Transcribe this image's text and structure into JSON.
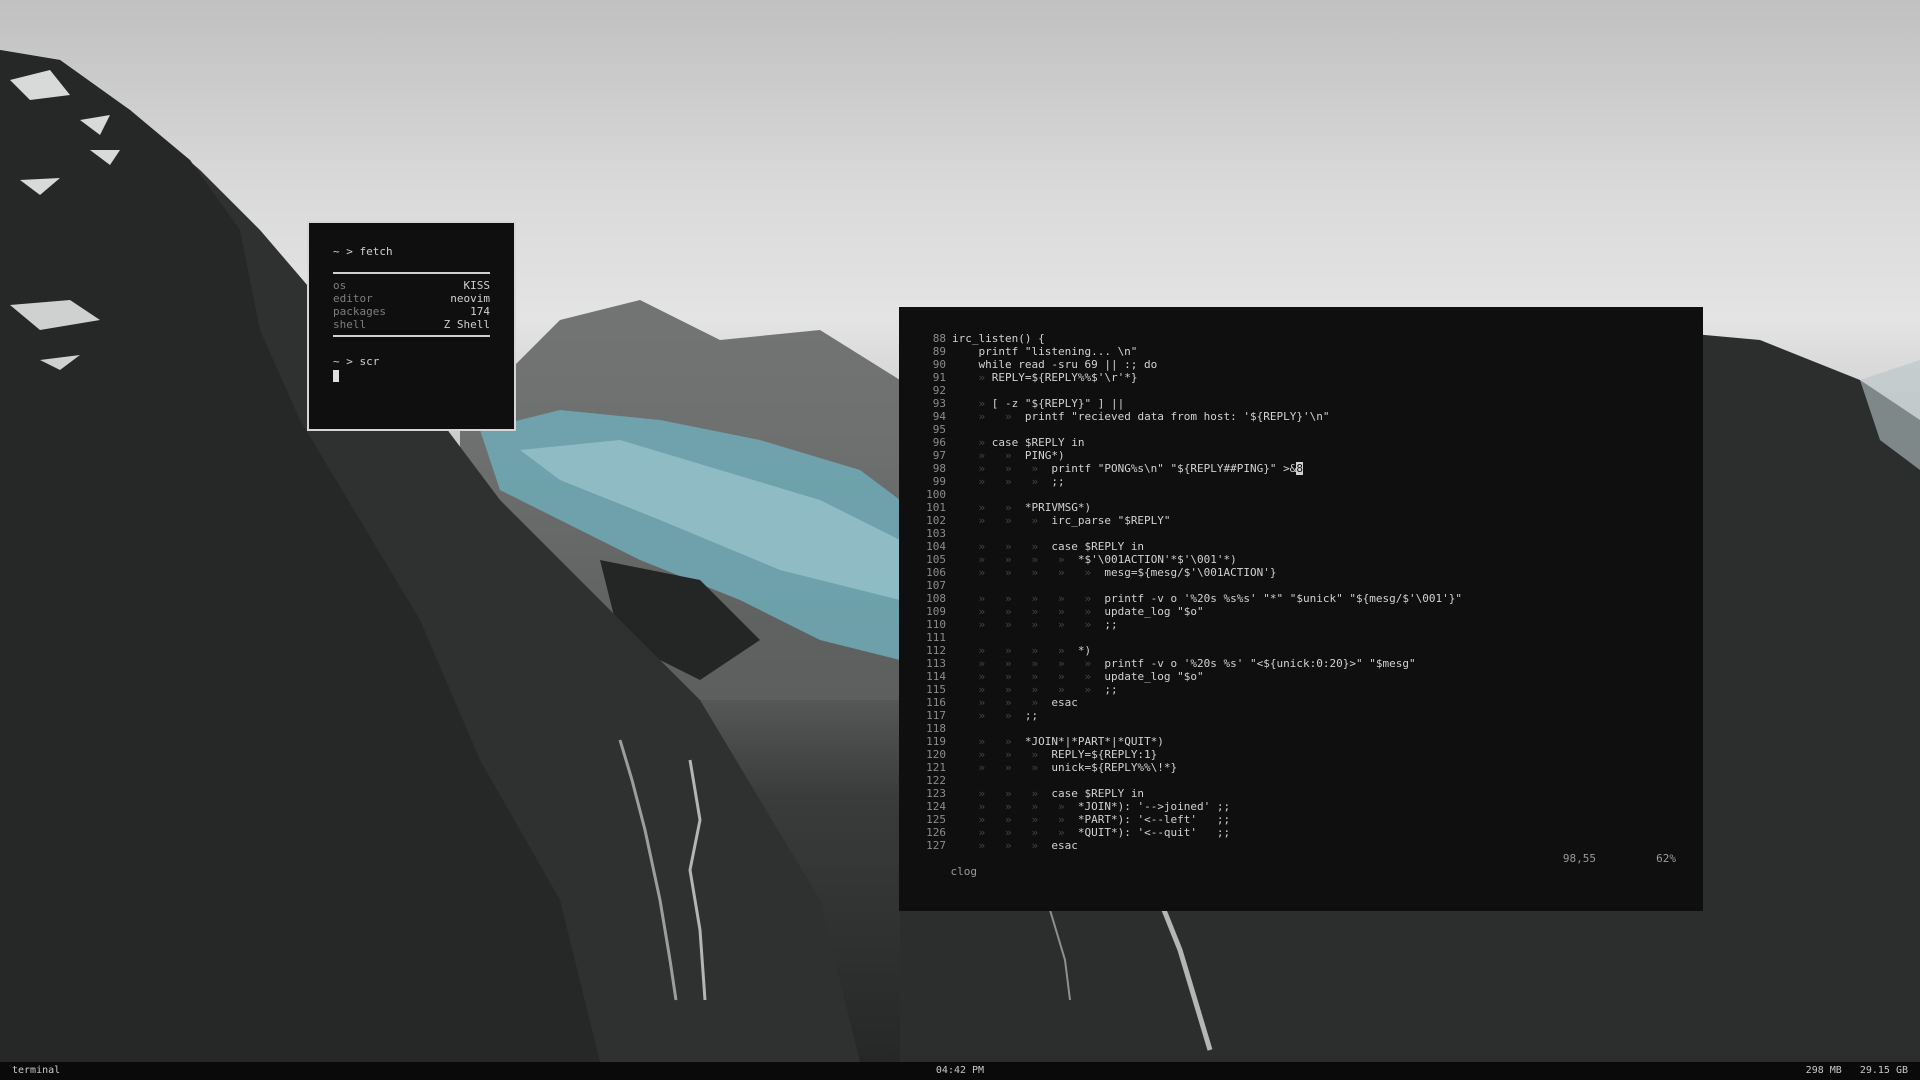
{
  "fetch": {
    "prompt1": "~ > fetch",
    "rows": [
      {
        "key": "os",
        "value": "KISS"
      },
      {
        "key": "editor",
        "value": "neovim"
      },
      {
        "key": "packages",
        "value": "174"
      },
      {
        "key": "shell",
        "value": "Z Shell"
      }
    ],
    "prompt2": "~ > scr"
  },
  "editor": {
    "lines": [
      {
        "n": "88",
        "t": "",
        "c": "irc_listen() {"
      },
      {
        "n": "89",
        "t": "",
        "c": "    printf \"listening... \\n\""
      },
      {
        "n": "90",
        "t": "",
        "c": "    while read -sru 69 || :; do"
      },
      {
        "n": "91",
        "t": "    » ",
        "c": "REPLY=${REPLY%%$'\\r'*}"
      },
      {
        "n": "92",
        "t": "",
        "c": ""
      },
      {
        "n": "93",
        "t": "    » ",
        "c": "[ -z \"${REPLY}\" ] ||"
      },
      {
        "n": "94",
        "t": "    »   »  ",
        "c": "printf \"recieved data from host: '${REPLY}'\\n\""
      },
      {
        "n": "95",
        "t": "",
        "c": ""
      },
      {
        "n": "96",
        "t": "    » ",
        "c": "case $REPLY in"
      },
      {
        "n": "97",
        "t": "    »   »  ",
        "c": "PING*)"
      },
      {
        "n": "98",
        "t": "    »   »   »  ",
        "c": "printf \"PONG%s\\n\" \"${REPLY##PING}\" >&8"
      },
      {
        "n": "99",
        "t": "    »   »   »  ",
        "c": ";;"
      },
      {
        "n": "100",
        "t": "",
        "c": ""
      },
      {
        "n": "101",
        "t": "    »   »  ",
        "c": "*PRIVMSG*)"
      },
      {
        "n": "102",
        "t": "    »   »   »  ",
        "c": "irc_parse \"$REPLY\""
      },
      {
        "n": "103",
        "t": "",
        "c": ""
      },
      {
        "n": "104",
        "t": "    »   »   »  ",
        "c": "case $REPLY in"
      },
      {
        "n": "105",
        "t": "    »   »   »   »  ",
        "c": "*$'\\001ACTION'*$'\\001'*)"
      },
      {
        "n": "106",
        "t": "    »   »   »   »   »  ",
        "c": "mesg=${mesg/$'\\001ACTION'}"
      },
      {
        "n": "107",
        "t": "",
        "c": ""
      },
      {
        "n": "108",
        "t": "    »   »   »   »   »  ",
        "c": "printf -v o '%20s %s%s' \"*\" \"$unick\" \"${mesg/$'\\001'}\""
      },
      {
        "n": "109",
        "t": "    »   »   »   »   »  ",
        "c": "update_log \"$o\""
      },
      {
        "n": "110",
        "t": "    »   »   »   »   »  ",
        "c": ";;"
      },
      {
        "n": "111",
        "t": "",
        "c": ""
      },
      {
        "n": "112",
        "t": "    »   »   »   »  ",
        "c": "*)"
      },
      {
        "n": "113",
        "t": "    »   »   »   »   »  ",
        "c": "printf -v o '%20s %s' \"<${unick:0:20}>\" \"$mesg\""
      },
      {
        "n": "114",
        "t": "    »   »   »   »   »  ",
        "c": "update_log \"$o\""
      },
      {
        "n": "115",
        "t": "    »   »   »   »   »  ",
        "c": ";;"
      },
      {
        "n": "116",
        "t": "    »   »   »  ",
        "c": "esac"
      },
      {
        "n": "117",
        "t": "    »   »  ",
        "c": ";;"
      },
      {
        "n": "118",
        "t": "",
        "c": ""
      },
      {
        "n": "119",
        "t": "    »   »  ",
        "c": "*JOIN*|*PART*|*QUIT*)"
      },
      {
        "n": "120",
        "t": "    »   »   »  ",
        "c": "REPLY=${REPLY:1}"
      },
      {
        "n": "121",
        "t": "    »   »   »  ",
        "c": "unick=${REPLY%%\\!*}"
      },
      {
        "n": "122",
        "t": "",
        "c": ""
      },
      {
        "n": "123",
        "t": "    »   »   »  ",
        "c": "case $REPLY in"
      },
      {
        "n": "124",
        "t": "    »   »   »   »  ",
        "c": "*JOIN*): '-->joined' ;;"
      },
      {
        "n": "125",
        "t": "    »   »   »   »  ",
        "c": "*PART*): '<--left'   ;;"
      },
      {
        "n": "126",
        "t": "    »   »   »   »  ",
        "c": "*QUIT*): '<--quit'   ;;"
      },
      {
        "n": "127",
        "t": "    »   »   »  ",
        "c": "esac"
      }
    ],
    "status": {
      "filename": "clog",
      "position": "98,55",
      "percent": "62%"
    }
  },
  "bar": {
    "left": "terminal",
    "center": "04:42 PM",
    "memory": "298 MB",
    "disk": "29.15 GB"
  },
  "colors": {
    "terminal_bg": "#0f0f0f",
    "text": "#c8c8c8",
    "border": "#d6d6d6"
  }
}
